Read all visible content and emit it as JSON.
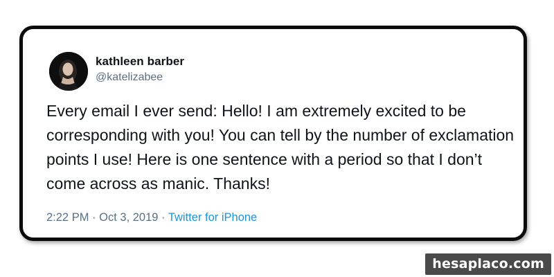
{
  "tweet": {
    "author": {
      "name": "kathleen barber",
      "handle": "@katelizabee",
      "avatar_icon": "profile-photo"
    },
    "text": "Every email I ever send: Hello! I am extremely excited to be corresponding with you! You can tell by the number of exclamation points I use! Here is one sentence with a period so that I don’t come across as manic. Thanks!",
    "time": "2:22 PM",
    "separator": "·",
    "date": "Oct 3, 2019",
    "source": "Twitter for iPhone"
  },
  "watermark": {
    "text": "hesaplaco.com"
  },
  "colors": {
    "text": "#0f1419",
    "secondary": "#5b7083",
    "link": "#1b95e0",
    "border": "#0b0b0b",
    "watermark_bg": "#4a4a4a"
  }
}
